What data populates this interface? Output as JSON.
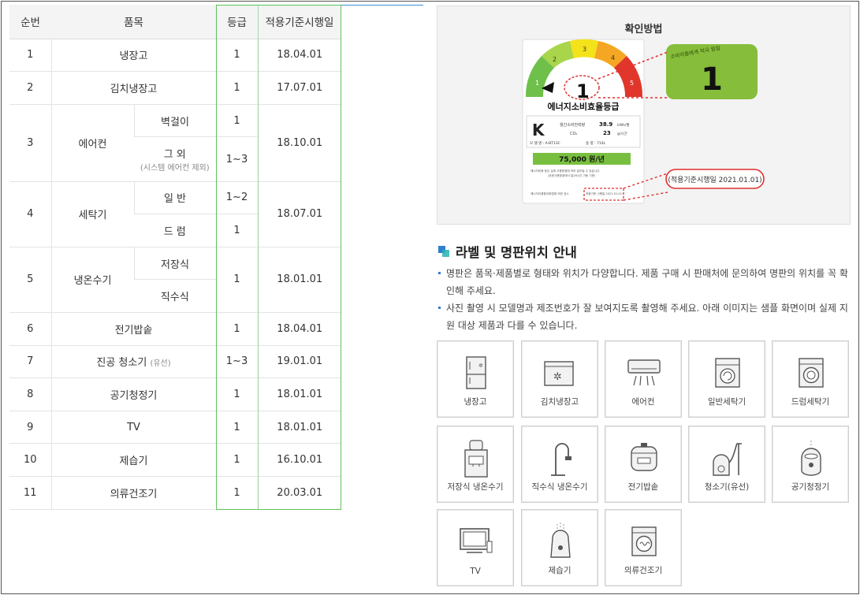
{
  "table": {
    "headers": [
      "순번",
      "품목",
      "등급",
      "적용기준시행일"
    ],
    "rows": [
      {
        "no": "1",
        "item": "냉장고",
        "grade": "1",
        "date": "18.04.01"
      },
      {
        "no": "2",
        "item": "김치냉장고",
        "grade": "1",
        "date": "17.07.01"
      },
      {
        "no": "3",
        "item": "에어컨",
        "subs": [
          {
            "label": "벽걸이",
            "note": "",
            "grade": "1"
          },
          {
            "label": "그 외",
            "note": "(시스템 에어컨 제외)",
            "grade": "1~3"
          }
        ],
        "date": "18.10.01"
      },
      {
        "no": "4",
        "item": "세탁기",
        "subs": [
          {
            "label": "일 반",
            "grade": "1~2"
          },
          {
            "label": "드 럼",
            "grade": "1"
          }
        ],
        "date": "18.07.01"
      },
      {
        "no": "5",
        "item": "냉온수기",
        "subs": [
          {
            "label": "저장식"
          },
          {
            "label": "직수식"
          }
        ],
        "grade": "1",
        "date": "18.01.01"
      },
      {
        "no": "6",
        "item": "전기밥솥",
        "grade": "1",
        "date": "18.04.01"
      },
      {
        "no": "7",
        "item": "진공 청소기",
        "item_small": "(유선)",
        "grade": "1~3",
        "date": "19.01.01"
      },
      {
        "no": "8",
        "item": "공기청정기",
        "grade": "1",
        "date": "18.01.01"
      },
      {
        "no": "9",
        "item": "TV",
        "grade": "1",
        "date": "18.01.01"
      },
      {
        "no": "10",
        "item": "제습기",
        "grade": "1",
        "date": "16.10.01"
      },
      {
        "no": "11",
        "item": "의류건조기",
        "grade": "1",
        "date": "20.03.01"
      }
    ]
  },
  "howto": {
    "title": "확인방법",
    "label_heading": "에너지소비효율등급",
    "big_grade": "1",
    "gauge_numbers": [
      "1",
      "2",
      "3",
      "4",
      "5"
    ],
    "kwh_label": "월간소비전력량",
    "kwh_value": "38.9",
    "kwh_unit": "kWh/월",
    "co2_label": "CO₂",
    "co2_value": "23",
    "co2_unit": "g/시간",
    "model_line": "모 델 명 : A-BT13C",
    "volume_line": "용 량 : 714L",
    "cost": "75,000 원/년",
    "fine1": "에너지비용 등은 실제 사용환경에 따라 달라질 수 있습니다.",
    "fine2": "(표준사용환경에서 일26시간 가동 기준)",
    "footer_small": "에너지이용합리화법에 의한 표시",
    "footer_date_small": "적용기준 시행일 2021.01.01",
    "callout_top": "소비자들에게 적극 알림",
    "callout_date": "(적용기준시행일 2021.01.01)"
  },
  "section": {
    "title": "라벨 및 명판위치 안내",
    "notes": [
      "명판은 품목·제품별로 형태와 위치가 다양합니다. 제품 구매 시 판매처에 문의하여 명판의 위치를 꼭 확인해 주세요.",
      "사진 촬영 시 모델명과 제조번호가 잘 보여지도록 촬영해 주세요. 아래 이미지는 샘플 화면이며 실제 지원 대상 제품과 다를 수 있습니다."
    ]
  },
  "cards": [
    {
      "label": "냉장고",
      "icon": "refrigerator-icon"
    },
    {
      "label": "김치냉장고",
      "icon": "kimchi-fridge-icon"
    },
    {
      "label": "에어컨",
      "icon": "air-conditioner-icon"
    },
    {
      "label": "일반세탁기",
      "icon": "top-load-washer-icon"
    },
    {
      "label": "드럼세탁기",
      "icon": "drum-washer-icon"
    },
    {
      "label": "저장식 냉온수기",
      "icon": "storage-water-dispenser-icon"
    },
    {
      "label": "직수식 냉온수기",
      "icon": "direct-water-dispenser-icon"
    },
    {
      "label": "전기밥솥",
      "icon": "rice-cooker-icon"
    },
    {
      "label": "청소기(유선)",
      "icon": "vacuum-cleaner-icon"
    },
    {
      "label": "공기청정기",
      "icon": "air-purifier-icon"
    },
    {
      "label": "TV",
      "icon": "tv-icon"
    },
    {
      "label": "제습기",
      "icon": "dehumidifier-icon"
    },
    {
      "label": "의류건조기",
      "icon": "clothes-dryer-icon"
    }
  ]
}
